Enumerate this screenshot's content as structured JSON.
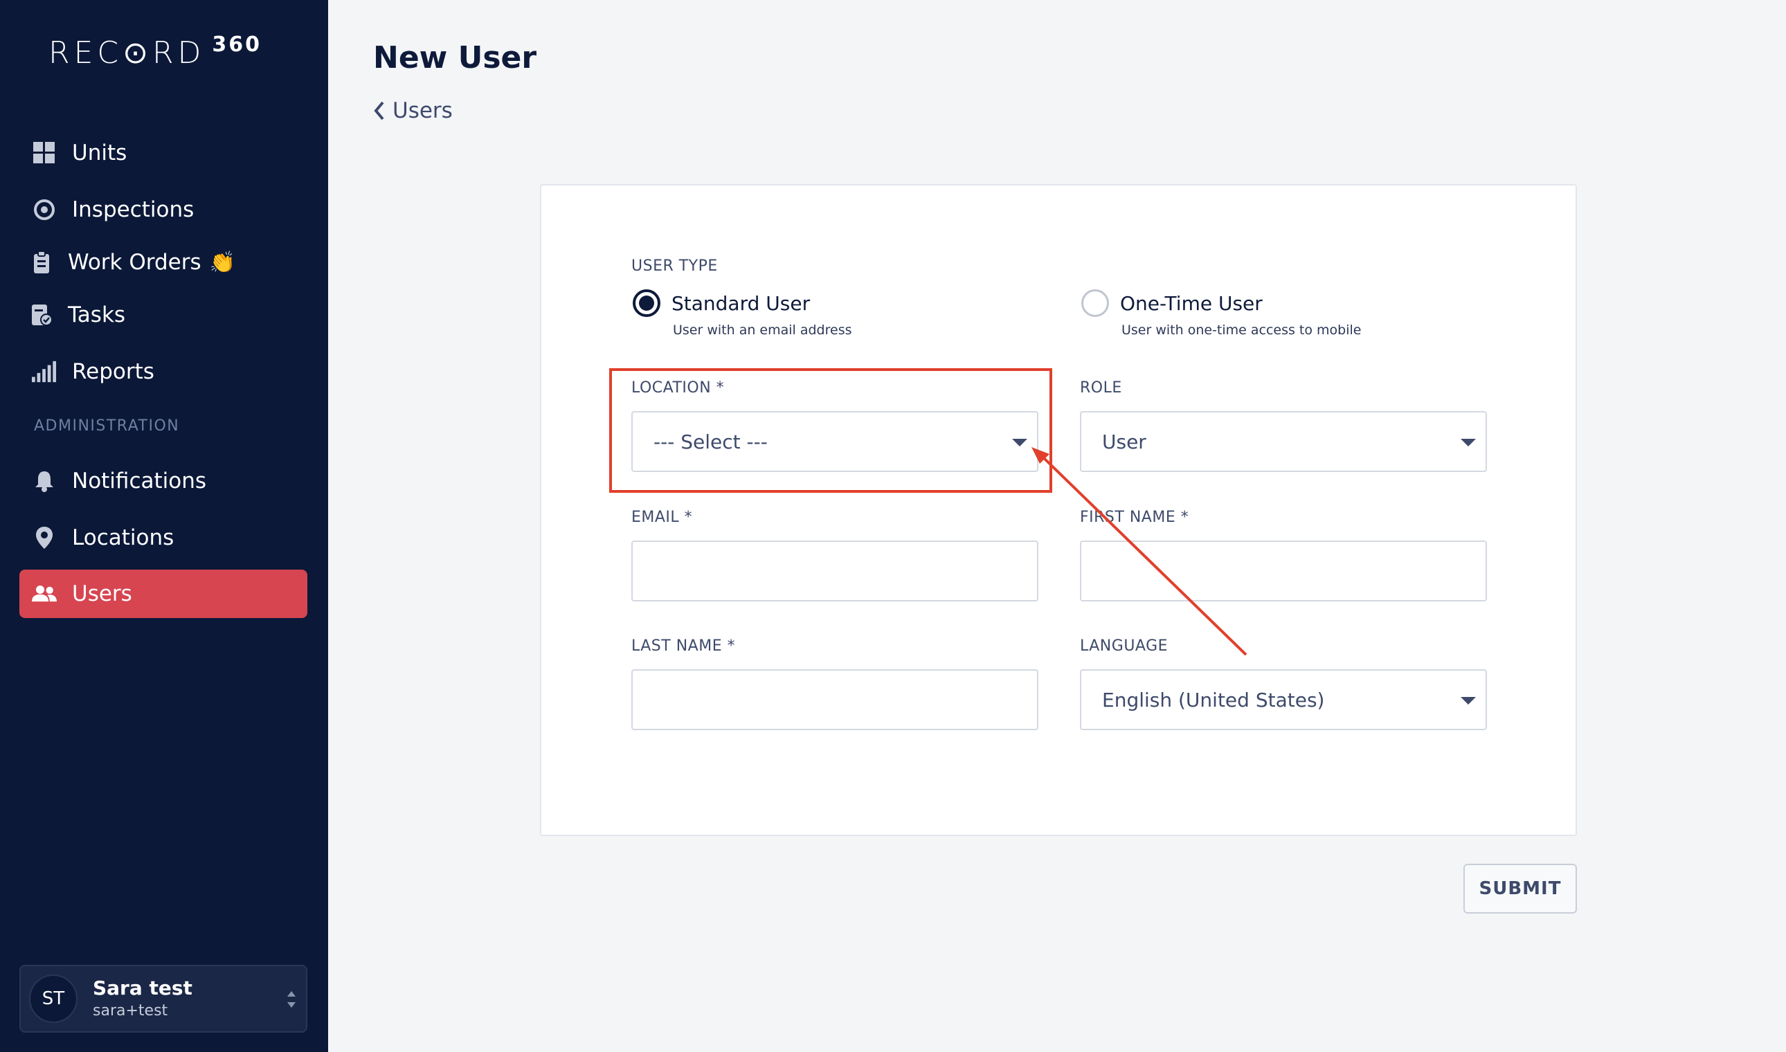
{
  "brand": {
    "word": "REC⊙RD",
    "number": "360"
  },
  "sidebar": {
    "items": [
      {
        "label": "Units",
        "icon": "grid-icon"
      },
      {
        "label": "Inspections",
        "icon": "target-icon"
      },
      {
        "label": "Work Orders",
        "icon": "clipboard-icon",
        "emoji": "👏"
      },
      {
        "label": "Tasks",
        "icon": "task-check-icon"
      },
      {
        "label": "Reports",
        "icon": "signal-bars-icon"
      }
    ],
    "admin_label": "ADMINISTRATION",
    "admin_items": [
      {
        "label": "Notifications",
        "icon": "bell-icon"
      },
      {
        "label": "Locations",
        "icon": "map-pin-icon"
      },
      {
        "label": "Users",
        "icon": "users-icon",
        "active": true
      }
    ]
  },
  "user": {
    "initials": "ST",
    "name": "Sara test",
    "email": "sara+test"
  },
  "page": {
    "title": "New User",
    "breadcrumb": "Users"
  },
  "form": {
    "user_type_label": "USER TYPE",
    "standard": {
      "title": "Standard User",
      "sub": "User with an email address",
      "selected": true
    },
    "onetime": {
      "title": "One-Time User",
      "sub": "User with one-time access to mobile",
      "selected": false
    },
    "location": {
      "label": "LOCATION *",
      "value": "--- Select ---"
    },
    "role": {
      "label": "ROLE",
      "value": "User"
    },
    "email": {
      "label": "EMAIL *",
      "value": ""
    },
    "first_name": {
      "label": "FIRST NAME *",
      "value": ""
    },
    "last_name": {
      "label": "LAST NAME *",
      "value": ""
    },
    "language": {
      "label": "LANGUAGE",
      "value": "English (United States)"
    },
    "submit_label": "SUBMIT"
  },
  "colors": {
    "sidebar_bg": "#0b1838",
    "active_item": "#d64550",
    "annotation": "#e0402c",
    "page_bg": "#f4f5f7"
  }
}
